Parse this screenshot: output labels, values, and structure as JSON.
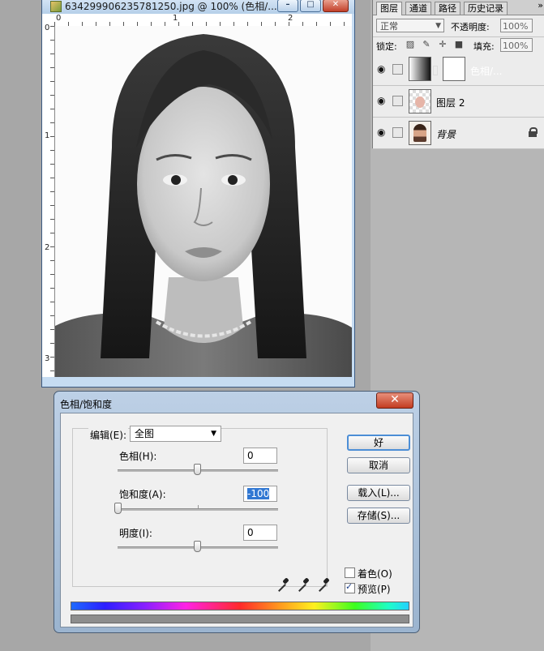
{
  "document": {
    "title": "634299906235781250.jpg @ 100% (色相/...",
    "ruler": {
      "h_labels": [
        "0",
        "1",
        "2"
      ],
      "v_labels": [
        "0",
        "1",
        "2",
        "3"
      ]
    }
  },
  "layers_panel": {
    "tabs": [
      "图层",
      "通道",
      "路径",
      "历史记录"
    ],
    "more_icon": "»",
    "blend_mode": "正常",
    "opacity_label": "不透明度:",
    "opacity_value": "100%",
    "lock_label": "锁定:",
    "fill_label": "填充:",
    "fill_value": "100%",
    "layers": [
      {
        "name": "色相/...",
        "type": "adjustment",
        "selected": true,
        "locked": false
      },
      {
        "name": "图层 2",
        "type": "pixel",
        "selected": false,
        "locked": false
      },
      {
        "name": "背景",
        "type": "pixel",
        "selected": false,
        "locked": true
      }
    ]
  },
  "dialog": {
    "title": "色相/饱和度",
    "close_label": "✕",
    "edit_label": "编辑(E):",
    "edit_value": "全图",
    "sliders": {
      "hue": {
        "label": "色相(H):",
        "value": "0"
      },
      "saturation": {
        "label": "饱和度(A):",
        "value": "-100"
      },
      "lightness": {
        "label": "明度(I):",
        "value": "0"
      }
    },
    "buttons": {
      "ok": "好",
      "cancel": "取消",
      "load": "载入(L)...",
      "save": "存储(S)..."
    },
    "colorize_label": "着色(O)",
    "colorize_checked": false,
    "preview_label": "预览(P)",
    "preview_checked": true
  },
  "colors": {
    "selection": "#3a6fd8",
    "dialog_frame": "#9bb4cf",
    "close_red": "#c33c21"
  }
}
